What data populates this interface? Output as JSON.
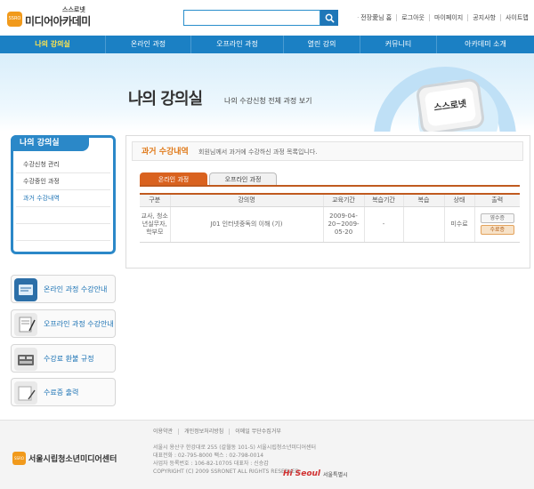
{
  "header": {
    "logo_small": "스스로넷",
    "logo_main": "미디어아카데미",
    "logo_badge": "SSRO",
    "search_placeholder": "",
    "util_links": [
      "전장愛님 홈",
      "로그아웃",
      "마이페이지",
      "공지사항",
      "사이트맵"
    ]
  },
  "nav": {
    "items": [
      "나의 강의실",
      "온라인 과정",
      "오프라인 과정",
      "열린 강의",
      "커뮤니티",
      "아카데미 소개"
    ],
    "active_index": 0
  },
  "banner": {
    "title": "나의 강의실",
    "subtitle": "나의 수강신청 전체 과정 보기",
    "tv_text": "스스로넷"
  },
  "sidebar": {
    "title": "나의 강의실",
    "items": [
      {
        "label": "수강신청 관리"
      },
      {
        "label": "수강중인 과정"
      },
      {
        "label": "과거 수강내역"
      }
    ],
    "active_index": 2,
    "quick_links": [
      {
        "label": "온라인 과정 수강안내",
        "icon": "online-guide-icon"
      },
      {
        "label": "오프라인 과정 수강안내",
        "icon": "offline-guide-icon"
      },
      {
        "label": "수강료 환불 규정",
        "icon": "refund-icon"
      },
      {
        "label": "수료증 출력",
        "icon": "certificate-icon"
      }
    ]
  },
  "content": {
    "section_title": "과거 수강내역",
    "section_desc": "회원님께서 과거에 수강하신 과정 목록입니다.",
    "tabs": [
      "온라인 과정",
      "오프라인 과정"
    ],
    "active_tab": 0,
    "table": {
      "headers": [
        "구분",
        "강의명",
        "교육기간",
        "복습기간",
        "복습",
        "상태",
        "출력"
      ],
      "rows": [
        {
          "category": "교사, 청소년실무자, 학부모",
          "course": "J01 인터넷중독의 이해 (기)",
          "period": "2009-04-20~2009-05-20",
          "review_period": "-",
          "review": "",
          "status": "미수료",
          "buttons": [
            "영수증",
            "수료증"
          ]
        }
      ]
    }
  },
  "footer": {
    "links": [
      "이용약관",
      "개인정보처리방침",
      "이메일 무단수집거부"
    ],
    "org_name": "서울시립청소년미디어센터",
    "info_lines": [
      "서울시 용산구 한강대로 255 (갈월동 101-5) 서울시립청소년미디어센터",
      "대표전화 : 02-795-8000   팩스 : 02-798-0014",
      "사업자 등록번호 : 106-82-10705 대표자 : 신승갑",
      "COPYRIGHT (C) 2009 SSRONET ALL RIGHTS RESERVED."
    ],
    "seoul_label": "서울특별시",
    "seoul_mark": "Hi Seoul"
  },
  "colors": {
    "primary_blue": "#1b80c4",
    "accent_orange": "#d9621f",
    "nav_active": "#ffe44d"
  }
}
